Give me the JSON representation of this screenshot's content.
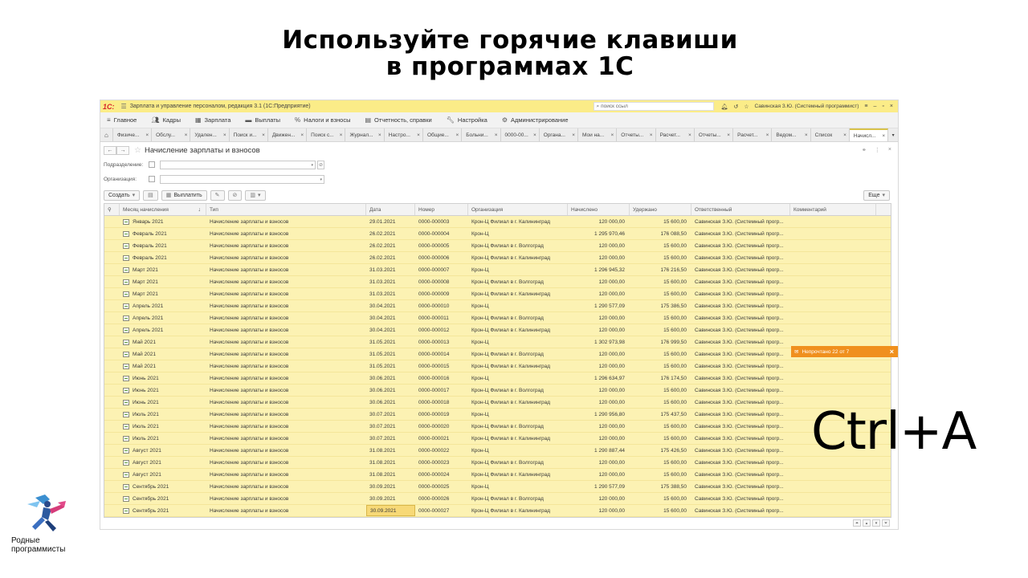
{
  "headline": {
    "line1": "Используйте горячие клавиши",
    "line2": "в программах 1С"
  },
  "window": {
    "logo": "1С:",
    "title": "Зарплата и управление персоналом, редакция 3.1  (1С:Предприятие)",
    "search_placeholder": "поиск ссыл",
    "user": "Савинская З.Ю. (Системный программист)"
  },
  "sections": [
    {
      "icon": "menu-icon",
      "label": "Главное"
    },
    {
      "icon": "people-icon",
      "label": "Кадры"
    },
    {
      "icon": "calculator-icon",
      "label": "Зарплата"
    },
    {
      "icon": "wallet-icon",
      "label": "Выплаты"
    },
    {
      "icon": "percent-icon",
      "label": "Налоги и взносы"
    },
    {
      "icon": "report-icon",
      "label": "Отчетность, справки"
    },
    {
      "icon": "wrench-icon",
      "label": "Настройка"
    },
    {
      "icon": "gear-icon",
      "label": "Администрирование"
    }
  ],
  "tabs": [
    "Физиче...",
    "Обслу...",
    "Удален...",
    "Поиск и...",
    "Движен...",
    "Поиск с...",
    "Журнал...",
    "Настро...",
    "Общие...",
    "Больни...",
    "0000-00...",
    "Органа...",
    "Мои на...",
    "Отчеты...",
    "Расчет...",
    "Отчеты...",
    "Расчет...",
    "Ведом...",
    "Список",
    "Начисл..."
  ],
  "form": {
    "title": "Начисление зарплаты и взносов",
    "filter_subdivision": "Подразделение:",
    "filter_org": "Организация:",
    "btn_create": "Создать",
    "btn_pay": "Выплатить",
    "btn_more": "Еще"
  },
  "columns": [
    "Месяц начисления",
    "Тип",
    "Дата",
    "Номер",
    "Организация",
    "Начислено",
    "Удержано",
    "Ответственный",
    "Комментарий"
  ],
  "rows": [
    [
      "Январь 2021",
      "Начисление зарплаты и взносов",
      "29.01.2021",
      "0000-000003",
      "Крон-Ц  Филиал в г. Калининград",
      "120 000,00",
      "15 600,00",
      "Савинская З.Ю. (Системный прогр..."
    ],
    [
      "Февраль 2021",
      "Начисление зарплаты и взносов",
      "26.02.2021",
      "0000-000004",
      "Крон-Ц",
      "1 295 970,46",
      "176 088,50",
      "Савинская З.Ю. (Системный прогр..."
    ],
    [
      "Февраль 2021",
      "Начисление зарплаты и взносов",
      "26.02.2021",
      "0000-000005",
      "Крон-Ц  Филиал в г. Волгоград",
      "120 000,00",
      "15 600,00",
      "Савинская З.Ю. (Системный прогр..."
    ],
    [
      "Февраль 2021",
      "Начисление зарплаты и взносов",
      "26.02.2021",
      "0000-000006",
      "Крон-Ц  Филиал в г. Калининград",
      "120 000,00",
      "15 600,00",
      "Савинская З.Ю. (Системный прогр..."
    ],
    [
      "Март 2021",
      "Начисление зарплаты и взносов",
      "31.03.2021",
      "0000-000007",
      "Крон-Ц",
      "1 296 945,32",
      "176 216,50",
      "Савинская З.Ю. (Системный прогр..."
    ],
    [
      "Март 2021",
      "Начисление зарплаты и взносов",
      "31.03.2021",
      "0000-000008",
      "Крон-Ц  Филиал в г. Волгоград",
      "120 000,00",
      "15 600,00",
      "Савинская З.Ю. (Системный прогр..."
    ],
    [
      "Март 2021",
      "Начисление зарплаты и взносов",
      "31.03.2021",
      "0000-000009",
      "Крон-Ц  Филиал в г. Калининград",
      "120 000,00",
      "15 600,00",
      "Савинская З.Ю. (Системный прогр..."
    ],
    [
      "Апрель 2021",
      "Начисление зарплаты и взносов",
      "30.04.2021",
      "0000-000010",
      "Крон-Ц",
      "1 290 577,09",
      "175 386,50",
      "Савинская З.Ю. (Системный прогр..."
    ],
    [
      "Апрель 2021",
      "Начисление зарплаты и взносов",
      "30.04.2021",
      "0000-000011",
      "Крон-Ц  Филиал в г. Волгоград",
      "120 000,00",
      "15 600,00",
      "Савинская З.Ю. (Системный прогр..."
    ],
    [
      "Апрель 2021",
      "Начисление зарплаты и взносов",
      "30.04.2021",
      "0000-000012",
      "Крон-Ц  Филиал в г. Калининград",
      "120 000,00",
      "15 600,00",
      "Савинская З.Ю. (Системный прогр..."
    ],
    [
      "Май 2021",
      "Начисление зарплаты и взносов",
      "31.05.2021",
      "0000-000013",
      "Крон-Ц",
      "1 302 973,98",
      "176 999,50",
      "Савинская З.Ю. (Системный прогр..."
    ],
    [
      "Май 2021",
      "Начисление зарплаты и взносов",
      "31.05.2021",
      "0000-000014",
      "Крон-Ц  Филиал в г. Волгоград",
      "120 000,00",
      "15 600,00",
      "Савинская З.Ю. (Системный прогр..."
    ],
    [
      "Май 2021",
      "Начисление зарплаты и взносов",
      "31.05.2021",
      "0000-000015",
      "Крон-Ц  Филиал в г. Калининград",
      "120 000,00",
      "15 600,00",
      "Савинская З.Ю. (Системный прогр..."
    ],
    [
      "Июнь 2021",
      "Начисление зарплаты и взносов",
      "30.06.2021",
      "0000-000016",
      "Крон-Ц",
      "1 296 634,97",
      "176 174,50",
      "Савинская З.Ю. (Системный прогр..."
    ],
    [
      "Июнь 2021",
      "Начисление зарплаты и взносов",
      "30.06.2021",
      "0000-000017",
      "Крон-Ц  Филиал в г. Волгоград",
      "120 000,00",
      "15 600,00",
      "Савинская З.Ю. (Системный прогр..."
    ],
    [
      "Июнь 2021",
      "Начисление зарплаты и взносов",
      "30.06.2021",
      "0000-000018",
      "Крон-Ц  Филиал в г. Калининград",
      "120 000,00",
      "15 600,00",
      "Савинская З.Ю. (Системный прогр..."
    ],
    [
      "Июль 2021",
      "Начисление зарплаты и взносов",
      "30.07.2021",
      "0000-000019",
      "Крон-Ц",
      "1 290 956,80",
      "175 437,50",
      "Савинская З.Ю. (Системный прогр..."
    ],
    [
      "Июль 2021",
      "Начисление зарплаты и взносов",
      "30.07.2021",
      "0000-000020",
      "Крон-Ц  Филиал в г. Волгоград",
      "120 000,00",
      "15 600,00",
      "Савинская З.Ю. (Системный прогр..."
    ],
    [
      "Июль 2021",
      "Начисление зарплаты и взносов",
      "30.07.2021",
      "0000-000021",
      "Крон-Ц  Филиал в г. Калининград",
      "120 000,00",
      "15 600,00",
      "Савинская З.Ю. (Системный прогр..."
    ],
    [
      "Август 2021",
      "Начисление зарплаты и взносов",
      "31.08.2021",
      "0000-000022",
      "Крон-Ц",
      "1 290 887,44",
      "175 426,50",
      "Савинская З.Ю. (Системный прогр..."
    ],
    [
      "Август 2021",
      "Начисление зарплаты и взносов",
      "31.08.2021",
      "0000-000023",
      "Крон-Ц  Филиал в г. Волгоград",
      "120 000,00",
      "15 600,00",
      "Савинская З.Ю. (Системный прогр..."
    ],
    [
      "Август 2021",
      "Начисление зарплаты и взносов",
      "31.08.2021",
      "0000-000024",
      "Крон-Ц  Филиал в г. Калининград",
      "120 000,00",
      "15 600,00",
      "Савинская З.Ю. (Системный прогр..."
    ],
    [
      "Сентябрь 2021",
      "Начисление зарплаты и взносов",
      "30.09.2021",
      "0000-000025",
      "Крон-Ц",
      "1 290 577,09",
      "175 388,50",
      "Савинская З.Ю. (Системный прогр..."
    ],
    [
      "Сентябрь 2021",
      "Начисление зарплаты и взносов",
      "30.09.2021",
      "0000-000026",
      "Крон-Ц  Филиал в г. Волгоград",
      "120 000,00",
      "15 600,00",
      "Савинская З.Ю. (Системный прогр..."
    ],
    [
      "Сентябрь 2021",
      "Начисление зарплаты и взносов",
      "30.09.2021",
      "0000-000027",
      "Крон-Ц  Филиал в г. Калининград",
      "120 000,00",
      "15 600,00",
      "Савинская З.Ю. (Системный прогр..."
    ]
  ],
  "notification": "Непрочтано 22 от 7",
  "hotkey": "Ctrl+A",
  "brand": {
    "line1": "Родные",
    "line2": "программисты"
  },
  "colors": {
    "title_bar": "#fbec88",
    "row_highlight": "#fcf2b3",
    "notification": "#f0901e",
    "logo_red": "#d7262c"
  }
}
